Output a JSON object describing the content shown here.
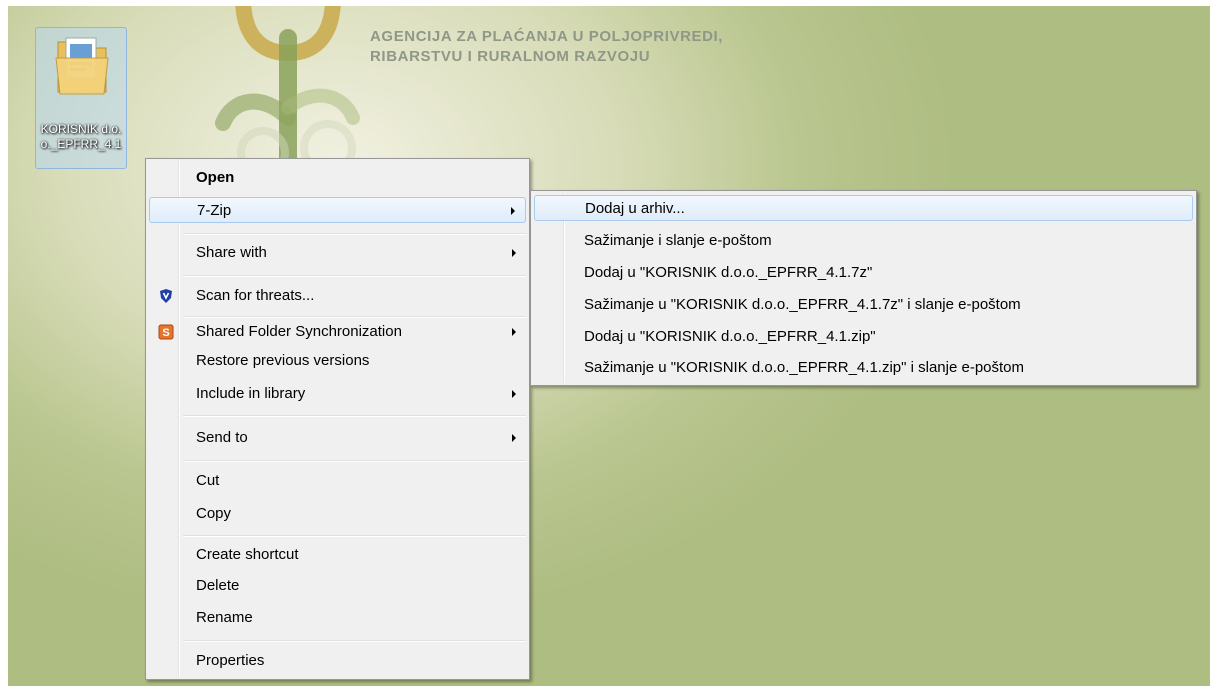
{
  "desktop": {
    "agency_line1": "AGENCIJA ZA PLAĆANJA U POLJOPRIVREDI,",
    "agency_line2": "RIBARSTVU I RURALNOM RAZVOJU",
    "folder": {
      "name": "KORISNIK d.o.o._EPFRR_4.1",
      "icon": "folder-icon"
    }
  },
  "context_menu": {
    "items": [
      {
        "label": "Open"
      },
      {
        "label": "7-Zip"
      },
      {
        "label": "Share with"
      },
      {
        "label": "Scan for threats...",
        "icon": "shield-icon"
      },
      {
        "label": "Shared Folder Synchronization",
        "icon": "sync-icon"
      },
      {
        "label": "Restore previous versions"
      },
      {
        "label": "Include in library"
      },
      {
        "label": "Send to"
      },
      {
        "label": "Cut"
      },
      {
        "label": "Copy"
      },
      {
        "label": "Create shortcut"
      },
      {
        "label": "Delete"
      },
      {
        "label": "Rename"
      },
      {
        "label": "Properties"
      }
    ]
  },
  "submenu_7zip": {
    "items": [
      {
        "label": "Dodaj u arhiv..."
      },
      {
        "label": "Sažimanje i slanje e-poštom"
      },
      {
        "label": "Dodaj u \"KORISNIK d.o.o._EPFRR_4.1.7z\""
      },
      {
        "label": "Sažimanje u \"KORISNIK d.o.o._EPFRR_4.1.7z\" i slanje e-poštom"
      },
      {
        "label": "Dodaj u \"KORISNIK d.o.o._EPFRR_4.1.zip\""
      },
      {
        "label": "Sažimanje u \"KORISNIK d.o.o._EPFRR_4.1.zip\" i slanje e-poštom"
      }
    ]
  },
  "colors": {
    "highlight_border": "#a9cbee",
    "menu_bg": "#f0f0f0",
    "desktop_green": "#aebd82"
  }
}
